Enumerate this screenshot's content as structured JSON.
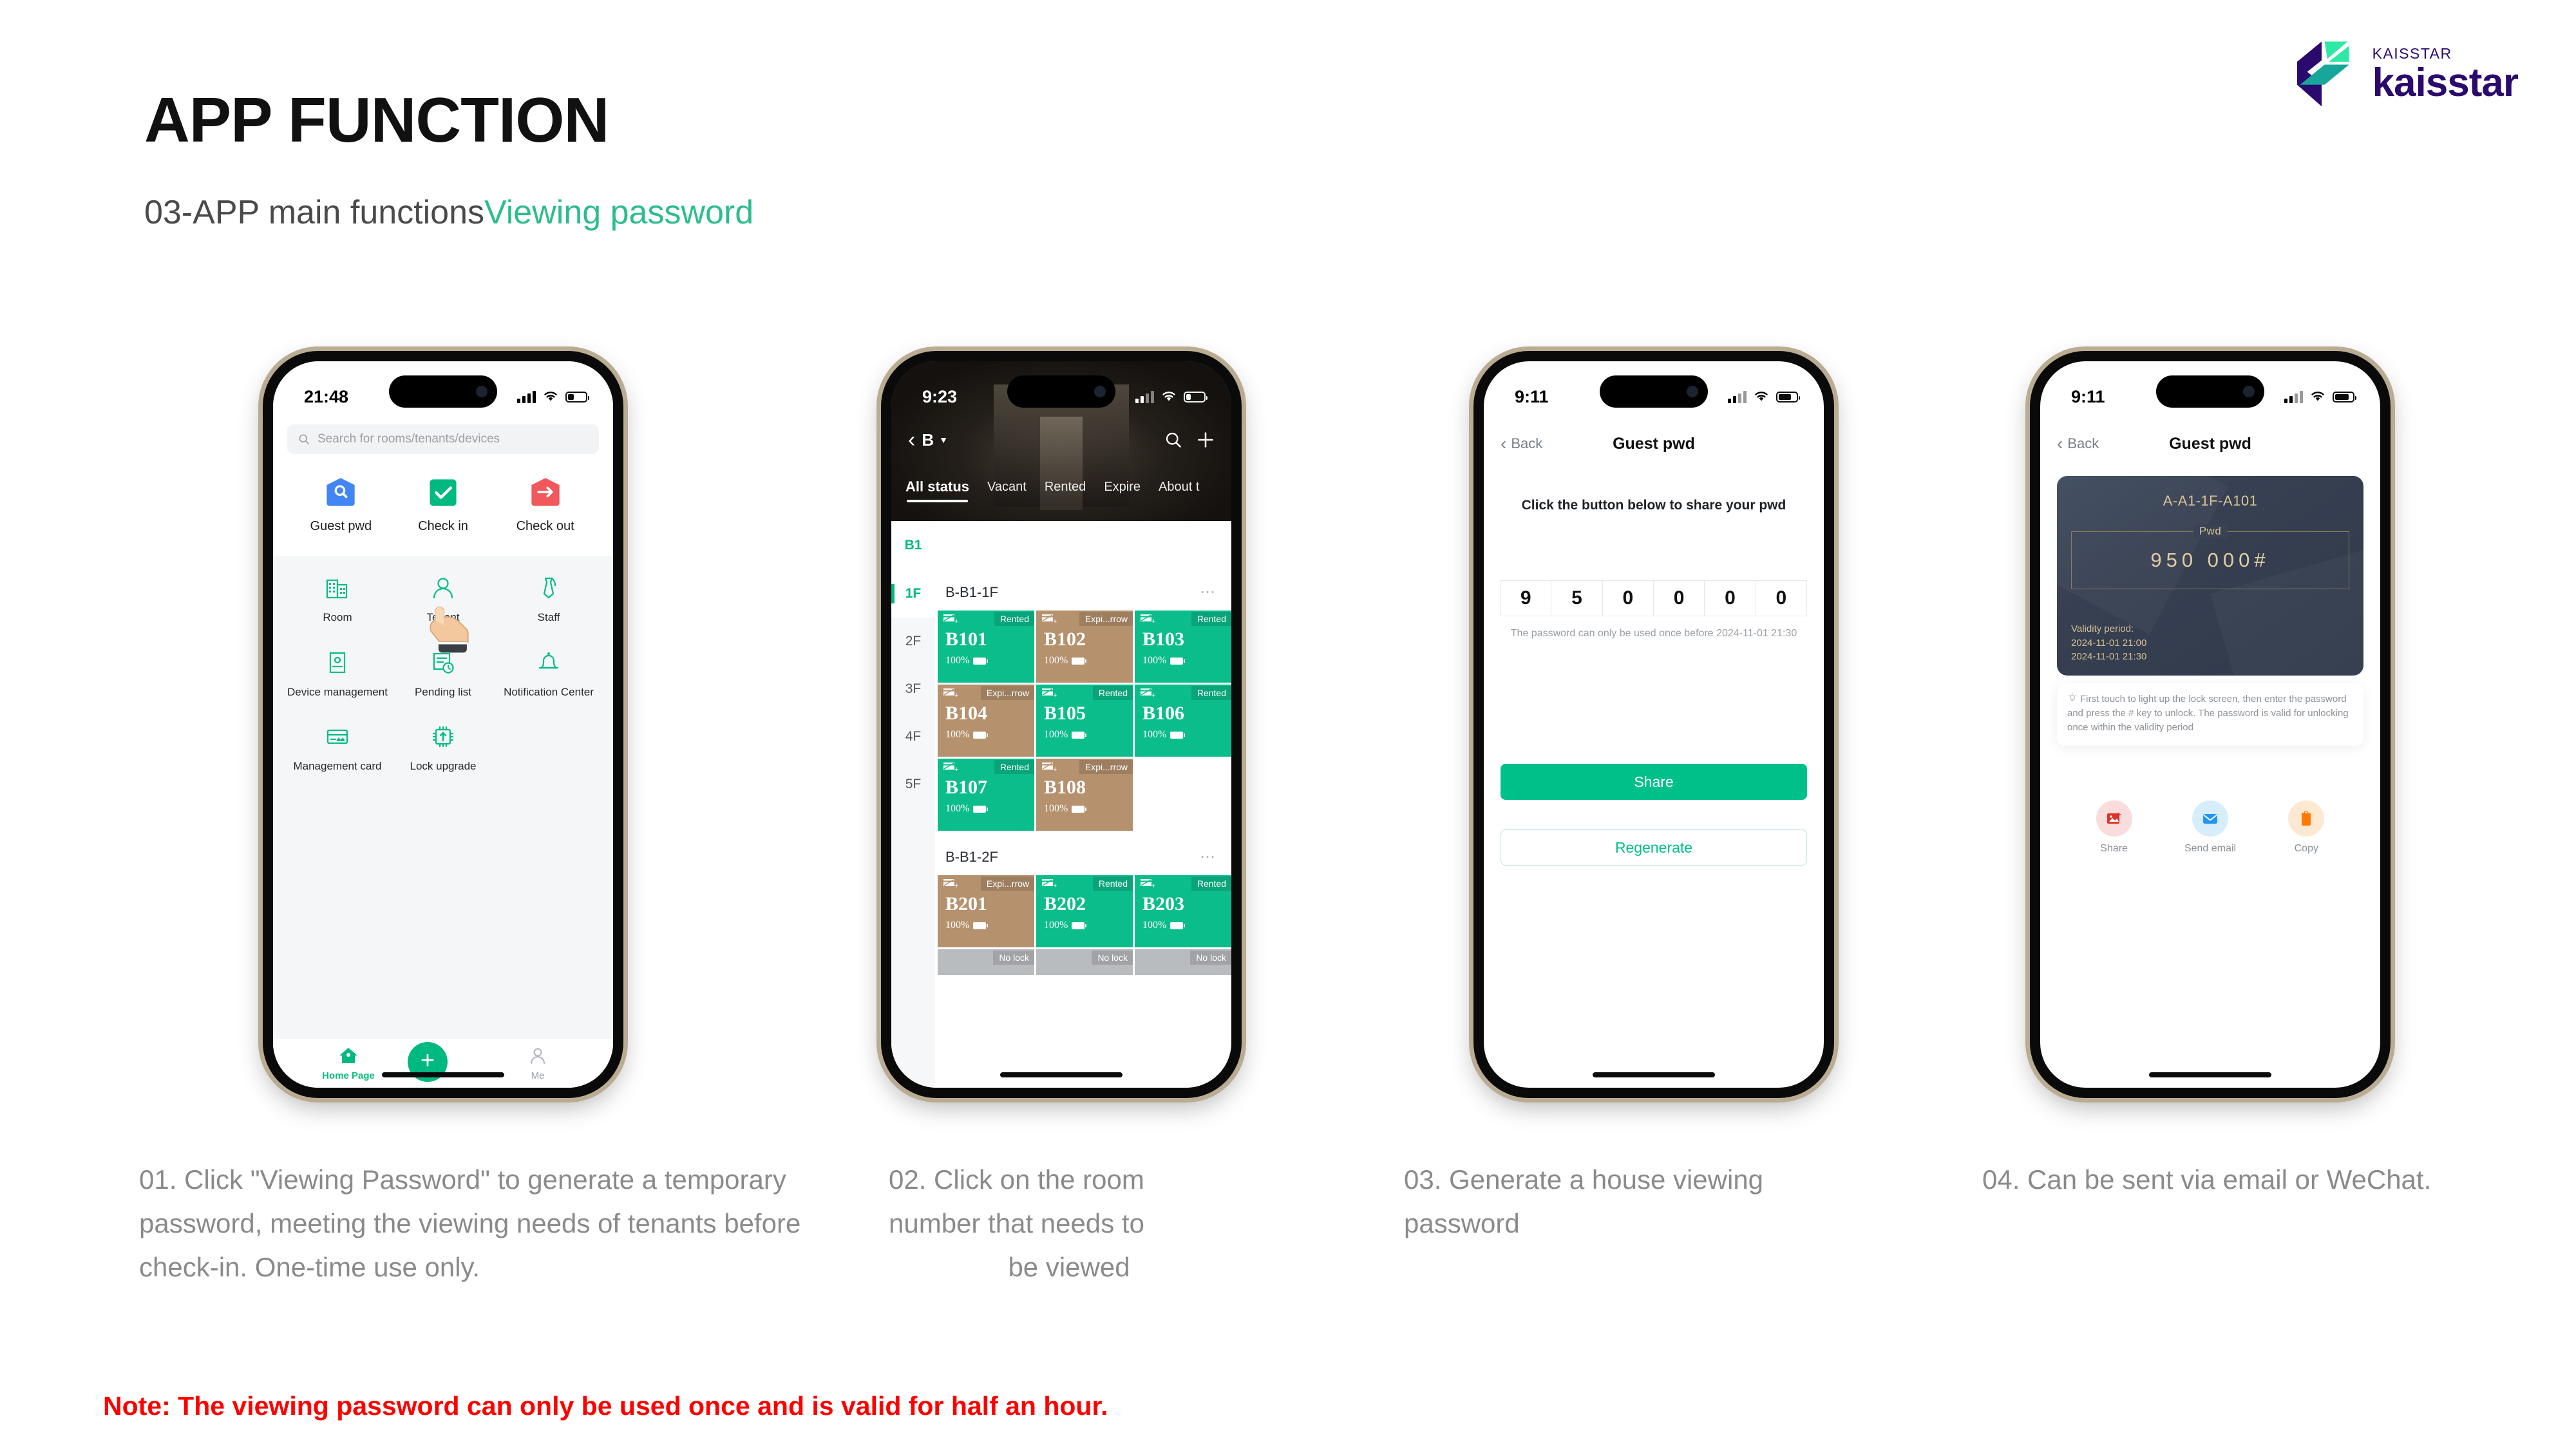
{
  "header": {
    "title": "APP FUNCTION",
    "subtitle_main": "03-APP main functions",
    "subtitle_accent": "Viewing password",
    "accent_color": "#2dbd8c"
  },
  "logo": {
    "small_text": "KAISSTAR",
    "big_text": "kaisstar",
    "brand_color": "#2b0a6e",
    "mark_green": "#2ee8a5",
    "mark_teal": "#17a79a"
  },
  "phone1": {
    "status": {
      "time": "21:48",
      "signal": "signal-bars",
      "wifi": "wifi-icon",
      "battery": "battery-icon"
    },
    "search_placeholder": "Search for rooms/tenants/devices",
    "quick_actions": [
      {
        "label": "Guest pwd",
        "icon": "house-search-icon",
        "color": "#4285f4"
      },
      {
        "label": "Check in",
        "icon": "check-square-icon",
        "color": "#00b980"
      },
      {
        "label": "Check out",
        "icon": "house-arrow-icon",
        "color": "#f0585c"
      }
    ],
    "grid": [
      {
        "label": "Room",
        "icon": "building-icon"
      },
      {
        "label": "Tenant",
        "icon": "person-icon"
      },
      {
        "label": "Staff",
        "icon": "tie-icon"
      },
      {
        "label": "Device management",
        "icon": "device-icon"
      },
      {
        "label": "Pending list",
        "icon": "pending-clock-icon"
      },
      {
        "label": "Notification Center",
        "icon": "bell-icon"
      },
      {
        "label": "Management card",
        "icon": "card-icon"
      },
      {
        "label": "Lock upgrade",
        "icon": "chip-upload-icon"
      }
    ],
    "tabbar": [
      {
        "label": "Home Page",
        "icon": "home-icon",
        "state": "active"
      },
      {
        "label": "",
        "icon": "plus-icon",
        "state": "fab"
      },
      {
        "label": "Me",
        "icon": "person-icon",
        "state": "inactive"
      }
    ]
  },
  "phone2": {
    "status": {
      "time": "9:23"
    },
    "building": "B",
    "tabs": [
      "All status",
      "Vacant",
      "Rented",
      "Expire",
      "About t"
    ],
    "active_tab": "All status",
    "floor_header": "B1",
    "floors": [
      "1F",
      "2F",
      "3F",
      "4F",
      "5F"
    ],
    "active_floor": "1F",
    "sections": [
      {
        "title": "B-B1-1F",
        "rooms": [
          {
            "name": "B101",
            "badge": "Rented",
            "battery": "100%",
            "state": "rented"
          },
          {
            "name": "B102",
            "badge": "Expi...rrow",
            "battery": "100%",
            "state": "expiring"
          },
          {
            "name": "B103",
            "badge": "Rented",
            "battery": "100%",
            "state": "rented"
          },
          {
            "name": "B104",
            "badge": "Expi...rrow",
            "battery": "100%",
            "state": "expiring"
          },
          {
            "name": "B105",
            "badge": "Rented",
            "battery": "100%",
            "state": "rented"
          },
          {
            "name": "B106",
            "badge": "Rented",
            "battery": "100%",
            "state": "rented"
          },
          {
            "name": "B107",
            "badge": "Rented",
            "battery": "100%",
            "state": "rented"
          },
          {
            "name": "B108",
            "badge": "Expi...rrow",
            "battery": "100%",
            "state": "expiring"
          }
        ]
      },
      {
        "title": "B-B1-2F",
        "rooms": [
          {
            "name": "B201",
            "badge": "Expi...rrow",
            "battery": "100%",
            "state": "expiring"
          },
          {
            "name": "B202",
            "badge": "Rented",
            "battery": "100%",
            "state": "rented"
          },
          {
            "name": "B203",
            "badge": "Rented",
            "battery": "100%",
            "state": "rented"
          }
        ],
        "partial_badges": [
          "No lock",
          "No lock",
          "No lock"
        ]
      }
    ],
    "colors": {
      "rented": "#0bbd8b",
      "expiring": "#b5916e",
      "nolock": "#b9bcbf"
    }
  },
  "phone3": {
    "status": {
      "time": "9:11"
    },
    "back_label": "Back",
    "title": "Guest pwd",
    "prompt": "Click the button below to share your pwd",
    "password_digits": [
      "9",
      "5",
      "0",
      "0",
      "0",
      "0"
    ],
    "note": "The password can only be used once before 2024-11-01 21:30",
    "share_button": "Share",
    "regenerate_button": "Regenerate"
  },
  "phone4": {
    "status": {
      "time": "9:11"
    },
    "back_label": "Back",
    "title": "Guest pwd",
    "room_code": "A-A1-1F-A101",
    "pwd_label": "Pwd",
    "pwd_value": "950  000#",
    "validity_label": "Validity period:",
    "validity_start": "2024-11-01 21:00",
    "validity_end": "2024-11-01 21:30",
    "tip": "First touch to light up the lock screen, then enter the password and press the # key to unlock. The password is valid for unlocking once within the validity period",
    "actions": [
      {
        "label": "Share",
        "icon": "image-share-icon",
        "bg": "#fadcdc",
        "fg": "#e03127"
      },
      {
        "label": "Send email",
        "icon": "envelope-icon",
        "bg": "#d6eefc",
        "fg": "#2196f3"
      },
      {
        "label": "Copy",
        "icon": "clipboard-icon",
        "bg": "#fde9d2",
        "fg": "#ff7a00"
      }
    ]
  },
  "captions": {
    "c1": "01. Click \"Viewing Password\" to generate a temporary password, meeting the viewing needs of tenants before check-in. One-time use only.",
    "c2_line1": "02. Click on the room",
    "c2_line2": "number that needs to",
    "c2_line3": "be viewed",
    "c3": "03. Generate a house viewing password",
    "c4": "04. Can be sent via email or WeChat."
  },
  "note": "Note: The viewing password can only be used once and is valid for half an hour."
}
